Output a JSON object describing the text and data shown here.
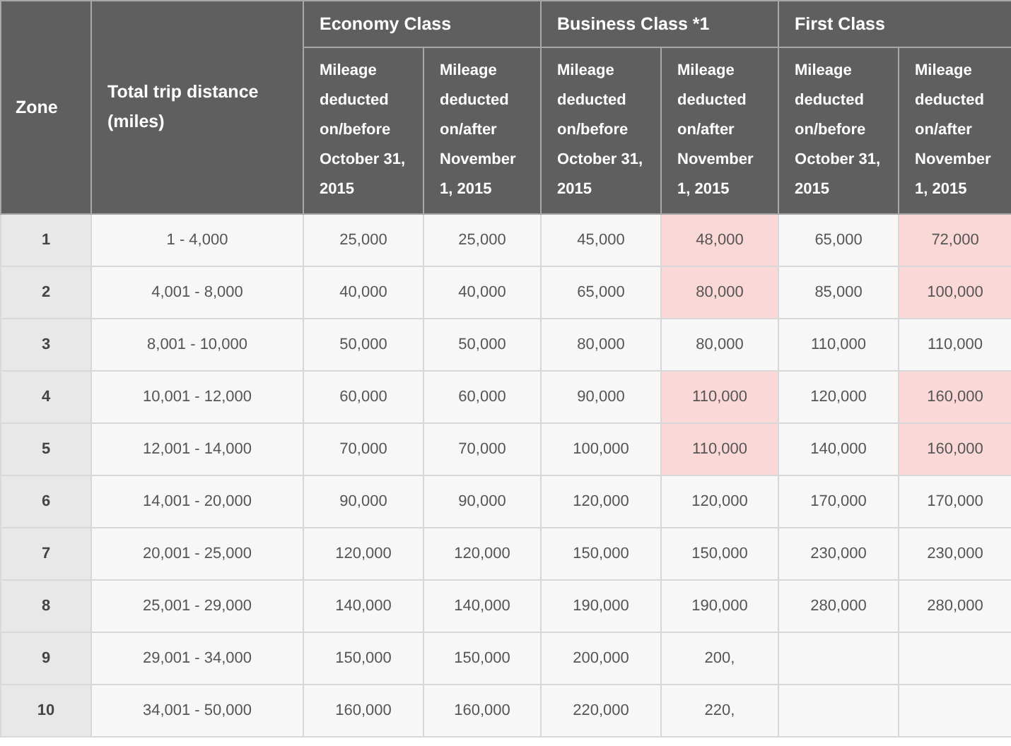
{
  "table": {
    "zone_heading": "Zone",
    "distance_heading": "Total trip distance (miles)",
    "classes": [
      {
        "name": "Economy Class",
        "columns": [
          "Mileage deducted on/before October 31, 2015",
          "Mileage deducted on/after November 1, 2015"
        ]
      },
      {
        "name": "Business Class *1",
        "columns": [
          "Mileage deducted on/before October 31, 2015",
          "Mileage deducted on/after November 1, 2015"
        ]
      },
      {
        "name": "First Class",
        "columns": [
          "Mileage deducted on/before October 31, 2015",
          "Mileage deducted on/after November 1, 2015"
        ]
      }
    ],
    "rows": [
      {
        "zone": "1",
        "distance": "1 - 4,000",
        "increased": true,
        "values": [
          "25,000",
          "25,000",
          "45,000",
          "48,000",
          "65,000",
          "72,000"
        ]
      },
      {
        "zone": "2",
        "distance": "4,001 - 8,000",
        "increased": true,
        "values": [
          "40,000",
          "40,000",
          "65,000",
          "80,000",
          "85,000",
          "100,000"
        ]
      },
      {
        "zone": "3",
        "distance": "8,001 - 10,000",
        "increased": false,
        "values": [
          "50,000",
          "50,000",
          "80,000",
          "80,000",
          "110,000",
          "110,000"
        ]
      },
      {
        "zone": "4",
        "distance": "10,001 - 12,000",
        "increased": true,
        "values": [
          "60,000",
          "60,000",
          "90,000",
          "110,000",
          "120,000",
          "160,000"
        ]
      },
      {
        "zone": "5",
        "distance": "12,001 - 14,000",
        "increased": true,
        "values": [
          "70,000",
          "70,000",
          "100,000",
          "110,000",
          "140,000",
          "160,000"
        ]
      },
      {
        "zone": "6",
        "distance": "14,001 - 20,000",
        "increased": false,
        "values": [
          "90,000",
          "90,000",
          "120,000",
          "120,000",
          "170,000",
          "170,000"
        ]
      },
      {
        "zone": "7",
        "distance": "20,001 - 25,000",
        "increased": false,
        "values": [
          "120,000",
          "120,000",
          "150,000",
          "150,000",
          "230,000",
          "230,000"
        ]
      },
      {
        "zone": "8",
        "distance": "25,001 - 29,000",
        "increased": false,
        "values": [
          "140,000",
          "140,000",
          "190,000",
          "190,000",
          "280,000",
          "280,000"
        ]
      },
      {
        "zone": "9",
        "distance": "29,001 - 34,000",
        "increased": false,
        "values": [
          "150,000",
          "150,000",
          "200,000",
          "200,"
        ]
      },
      {
        "zone": "10",
        "distance": "34,001 - 50,000",
        "increased": false,
        "values": [
          "160,000",
          "160,000",
          "220,000",
          "220,"
        ]
      }
    ]
  }
}
